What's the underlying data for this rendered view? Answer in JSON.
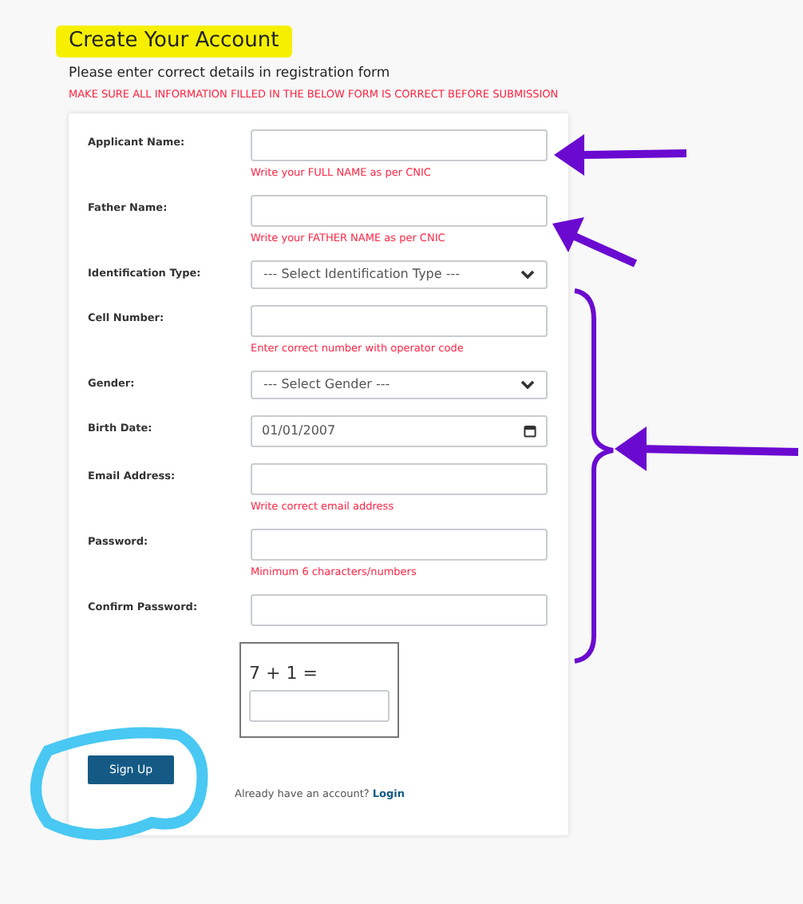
{
  "title": "Create Your Account",
  "subtitle": "Please enter correct details in registration form",
  "warning": "MAKE SURE ALL INFORMATION FILLED IN THE BELOW FORM IS CORRECT BEFORE SUBMISSION",
  "fields": [
    {
      "kind": "text",
      "label": "Applicant Name:",
      "hint": "Write your FULL NAME as per CNIC"
    },
    {
      "kind": "text",
      "label": "Father Name:",
      "hint": "Write your FATHER NAME as per CNIC"
    },
    {
      "kind": "select",
      "label": "Identification Type:",
      "placeholder": "--- Select Identification Type ---"
    },
    {
      "kind": "text",
      "label": "Cell Number:",
      "hint": "Enter correct number with operator code"
    },
    {
      "kind": "select",
      "label": "Gender:",
      "placeholder": "--- Select Gender ---"
    },
    {
      "kind": "date",
      "label": "Birth Date:",
      "value": "01/01/2007"
    },
    {
      "kind": "text",
      "label": "Email Address:",
      "hint": "Write correct email address"
    },
    {
      "kind": "text",
      "label": "Password:",
      "hint": "Minimum 6 characters/numbers"
    },
    {
      "kind": "text",
      "label": "Confirm Password:"
    }
  ],
  "captcha": {
    "question": "7 + 1 ="
  },
  "signup_button": "Sign Up",
  "login_prompt": {
    "text": "Already have an account?",
    "link": "Login"
  }
}
